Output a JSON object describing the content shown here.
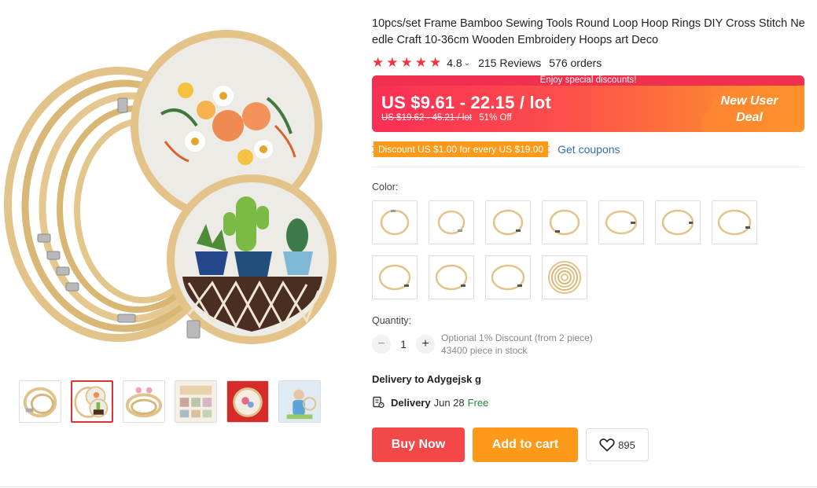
{
  "product": {
    "title": "10pcs/set Frame Bamboo Sewing Tools Round Loop Hoop Rings DIY Cross Stitch Needle Craft 10-36cm Wooden Embroidery Hoops art Deco",
    "rating": "4.8",
    "rating_value": 4.8,
    "reviews": "215 Reviews",
    "orders": "576 orders"
  },
  "price": {
    "banner_top": "Enjoy special discounts!",
    "current": "US $9.61 - 22.15 / lot",
    "original": "US $19.62 - 45.21 / lot",
    "discount": "51% Off",
    "deal_line1": "New User",
    "deal_line2": "Deal"
  },
  "coupon": {
    "tag": "Discount US $1.00 for every US $19.00",
    "link": "Get coupons"
  },
  "color": {
    "label": "Color:",
    "swatch_count": 11
  },
  "quantity": {
    "label": "Quantity:",
    "minus": "−",
    "value": "1",
    "plus": "+",
    "note_line1": "Optional 1% Discount (from 2 piece)",
    "note_line2": "43400 piece in stock"
  },
  "delivery": {
    "to": "Delivery to Adygejsk g",
    "label": "Delivery",
    "date": "Jun 28",
    "free": "Free"
  },
  "actions": {
    "buy_now": "Buy Now",
    "add_to_cart": "Add to cart",
    "wishlist_count": "895"
  },
  "colors": {
    "accent_red": "#f44848",
    "accent_orange": "#fd9a1a",
    "link_blue": "#2f6fb0",
    "free_green": "#1e8a3e"
  }
}
